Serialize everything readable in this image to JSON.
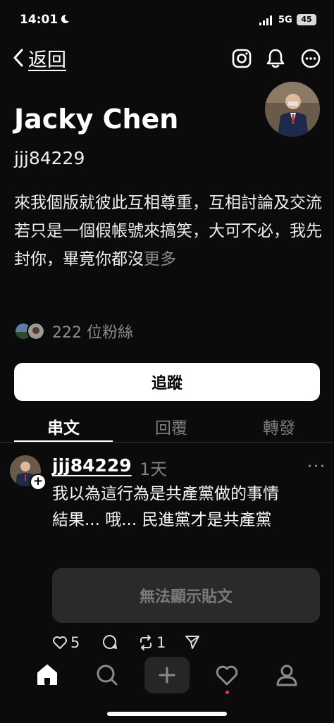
{
  "status_bar": {
    "time": "14:01",
    "network": "5G",
    "battery": "45"
  },
  "header": {
    "back_label": "返回"
  },
  "profile": {
    "name": "Jacky Chen",
    "handle": "jjj84229",
    "bio_lines": [
      "來我個版就彼此互相尊重，互相討論及交流",
      "若只是一個假帳號來搞笑，大可不必，我先封你，畢竟你都沒"
    ],
    "bio_more": "更多",
    "followers": "222 位粉絲",
    "follow_button": "追蹤"
  },
  "tabs": [
    {
      "label": "串文",
      "active": true
    },
    {
      "label": "回覆",
      "active": false
    },
    {
      "label": "轉發",
      "active": false
    }
  ],
  "post": {
    "username": "jjj84229",
    "time": "1天",
    "more": "···",
    "lines": [
      "我以為這行為是共產黨做的事情",
      "結果... 哦... 民進黨才是共產黨"
    ],
    "unavailable": "無法顯示貼文",
    "likes": "5",
    "reposts": "1"
  },
  "colors": {
    "background": "#0b0b0b",
    "accent_dot": "#ff3040"
  }
}
